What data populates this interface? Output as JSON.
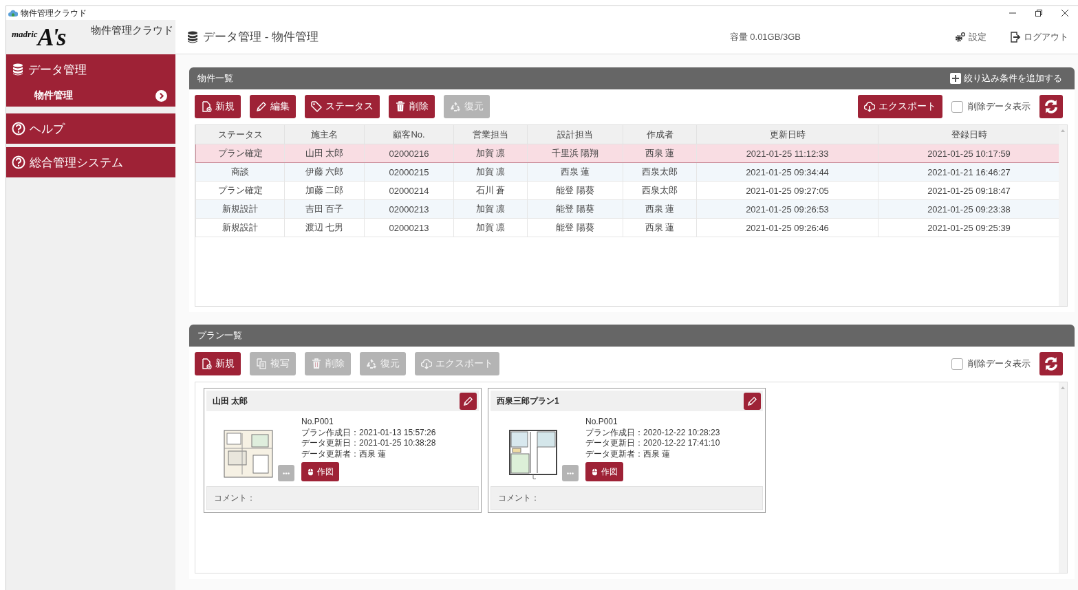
{
  "window": {
    "title": "物件管理クラウド"
  },
  "sidebar": {
    "logo": {
      "wordmark": "madric",
      "mark": "A's"
    },
    "app_name": "物件管理クラウド",
    "items": [
      {
        "label": "データ管理",
        "kind": "database",
        "children": [
          {
            "label": "物件管理",
            "selected": true
          }
        ]
      },
      {
        "label": "ヘルプ",
        "kind": "help"
      },
      {
        "label": "総合管理システム",
        "kind": "help"
      }
    ]
  },
  "header": {
    "title": "データ管理 - 物件管理",
    "storage": "容量 0.01GB/3GB",
    "actions": [
      {
        "label": "設定",
        "kind": "settings"
      },
      {
        "label": "ログアウト",
        "kind": "logout"
      }
    ]
  },
  "property_panel": {
    "title": "物件一覧",
    "filter_link": "絞り込み条件を追加する",
    "toolbar": [
      {
        "label": "新規",
        "kind": "new",
        "disabled": false
      },
      {
        "label": "編集",
        "kind": "edit",
        "disabled": false
      },
      {
        "label": "ステータス",
        "kind": "tag",
        "disabled": false
      },
      {
        "label": "削除",
        "kind": "delete",
        "disabled": false
      },
      {
        "label": "復元",
        "kind": "restore",
        "disabled": true
      }
    ],
    "export": {
      "label": "エクスポート",
      "disabled": false
    },
    "show_deleted": {
      "label": "削除データ表示",
      "checked": false
    },
    "table": {
      "columns": [
        "ステータス",
        "施主名",
        "顧客No.",
        "営業担当",
        "設計担当",
        "作成者",
        "更新日時",
        "登録日時"
      ],
      "rows": [
        {
          "cells": [
            "プラン確定",
            "山田 太郎",
            "02000216",
            "加賀 凛",
            "千里浜 陽翔",
            "西泉 蓮",
            "2021-01-25 11:12:33",
            "2021-01-25 10:17:59"
          ],
          "selected": true
        },
        {
          "cells": [
            "商談",
            "伊藤 六郎",
            "02000215",
            "加賀 凛",
            "西泉 蓮",
            "西泉太郎",
            "2021-01-25 09:34:44",
            "2021-01-21 16:46:27"
          ],
          "selected": false
        },
        {
          "cells": [
            "プラン確定",
            "加藤 二郎",
            "02000214",
            "石川 蒼",
            "能登 陽葵",
            "西泉太郎",
            "2021-01-25 09:27:05",
            "2021-01-25 09:18:47"
          ],
          "selected": false
        },
        {
          "cells": [
            "新規設計",
            "吉田 百子",
            "02000213",
            "加賀 凛",
            "能登 陽葵",
            "西泉 蓮",
            "2021-01-25 09:26:53",
            "2021-01-25 09:23:38"
          ],
          "selected": false
        },
        {
          "cells": [
            "新規設計",
            "渡辺 七男",
            "02000213",
            "加賀 凛",
            "能登 陽葵",
            "西泉 蓮",
            "2021-01-25 09:26:46",
            "2021-01-25 09:25:39"
          ],
          "selected": false
        }
      ]
    }
  },
  "plan_panel": {
    "title": "プラン一覧",
    "toolbar": [
      {
        "label": "新規",
        "kind": "new",
        "disabled": false
      },
      {
        "label": "複写",
        "kind": "copy",
        "disabled": true
      },
      {
        "label": "削除",
        "kind": "delete",
        "disabled": true
      },
      {
        "label": "復元",
        "kind": "restore",
        "disabled": true
      },
      {
        "label": "エクスポート",
        "kind": "export",
        "disabled": true
      }
    ],
    "show_deleted": {
      "label": "削除データ表示",
      "checked": false
    },
    "cards": [
      {
        "title": "山田 太郎",
        "details": [
          "No.P001",
          "プラン作成日：2021-01-13 15:57:26",
          "データ更新日：2021-01-25 10:38:28",
          "データ更新者：西泉 蓮"
        ],
        "draw_button": "作図",
        "comment_label": "コメント："
      },
      {
        "title": "西泉三郎プラン1",
        "details": [
          "No.P001",
          "プラン作成日：2020-12-22 10:28:23",
          "データ更新日：2020-12-22 17:41:10",
          "データ更新者：西泉 蓮"
        ],
        "draw_button": "作図",
        "comment_label": "コメント："
      }
    ]
  }
}
